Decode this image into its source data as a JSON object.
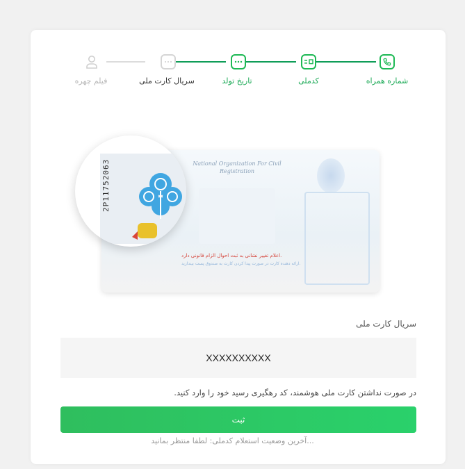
{
  "stepper": {
    "steps": [
      {
        "label": "شماره همراه",
        "state": "done",
        "icon": "phone-icon"
      },
      {
        "label": "کدملی",
        "state": "done",
        "icon": "id-card-icon"
      },
      {
        "label": "تاریخ تولد",
        "state": "done",
        "icon": "calendar-dots-icon"
      },
      {
        "label": "سریال کارت ملی",
        "state": "current",
        "icon": "dots-icon"
      },
      {
        "label": "فیلم چهره",
        "state": "future",
        "icon": "user-icon"
      }
    ]
  },
  "card_image": {
    "english_text": "National Organization For Civil Registration",
    "red_text": "اعلام تغییر نشانی به ثبت احوال الزام قانونی دارد.",
    "blue_text": "ارائه دهنده کارت در صورت پیدا کردن کارت به صندوق پست بیندازید.",
    "serial": "2P11752063"
  },
  "form": {
    "field_label": "سریال کارت ملی",
    "input_value": "XXXXXXXXXX",
    "hint": "در صورت نداشتن کارت ملی هوشمند، کد رهگیری رسید خود را وارد کنید.",
    "submit_label": "ثبت",
    "status": "...آخرین وضعیت استعلام کدملی: لطفا منتظر بمانید"
  },
  "colors": {
    "accent": "#1db954",
    "button": "#2ac864",
    "inactive": "#d5d5d5"
  }
}
